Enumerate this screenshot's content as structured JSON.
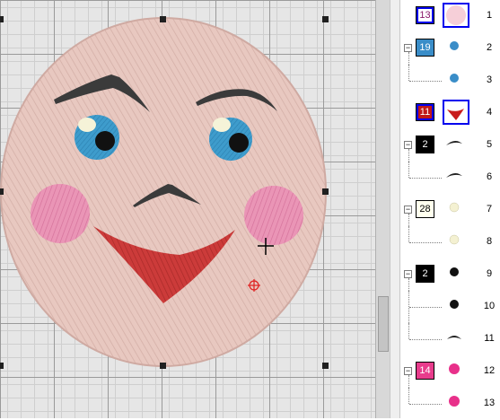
{
  "canvas": {
    "grid_color": "#9a9a9a",
    "background_color": "#e6e6e6",
    "face_color": "#e8c8c0",
    "eyebrow_color": "#3b3b3b",
    "eye_color": "#3a9ac8",
    "cheek_color": "#e890b4",
    "mouth_color": "#cc3b3a"
  },
  "color_sequence": [
    {
      "index": "1",
      "swatch": "13",
      "swatch_color": "#ffffff",
      "swatch_text_color": "#8a1a6a",
      "shape": "circle-pink-icon",
      "selected": true,
      "expander": ""
    },
    {
      "index": "2",
      "swatch": "19",
      "swatch_color": "#3a8dc8",
      "swatch_text_color": "#ffffff",
      "shape": "dot-blue-icon",
      "selected": false,
      "expander": "−"
    },
    {
      "index": "3",
      "swatch": "",
      "swatch_color": "",
      "swatch_text_color": "",
      "shape": "dot-blue-icon",
      "selected": false,
      "expander": ""
    },
    {
      "index": "4",
      "swatch": "11",
      "swatch_color": "#c01818",
      "swatch_text_color": "#ffffff",
      "shape": "mouth-red-icon",
      "selected": true,
      "expander": ""
    },
    {
      "index": "5",
      "swatch": "2",
      "swatch_color": "#000000",
      "swatch_text_color": "#ffffff",
      "shape": "eyebrow-icon",
      "selected": false,
      "expander": "−"
    },
    {
      "index": "6",
      "swatch": "",
      "swatch_color": "",
      "swatch_text_color": "",
      "shape": "eyebrow-icon",
      "selected": false,
      "expander": ""
    },
    {
      "index": "7",
      "swatch": "28",
      "swatch_color": "#ffffee",
      "swatch_text_color": "#000000",
      "shape": "dot-cream-icon",
      "selected": false,
      "expander": "−"
    },
    {
      "index": "8",
      "swatch": "",
      "swatch_color": "",
      "swatch_text_color": "",
      "shape": "dot-cream-icon",
      "selected": false,
      "expander": ""
    },
    {
      "index": "9",
      "swatch": "2",
      "swatch_color": "#000000",
      "swatch_text_color": "#ffffff",
      "shape": "dot-black-icon",
      "selected": false,
      "expander": "−"
    },
    {
      "index": "10",
      "swatch": "",
      "swatch_color": "",
      "swatch_text_color": "",
      "shape": "dot-black-icon",
      "selected": false,
      "expander": ""
    },
    {
      "index": "11",
      "swatch": "",
      "swatch_color": "",
      "swatch_text_color": "",
      "shape": "nose-icon",
      "selected": false,
      "expander": ""
    },
    {
      "index": "12",
      "swatch": "14",
      "swatch_color": "#e83c8c",
      "swatch_text_color": "#ffffff",
      "shape": "dot-pink-icon",
      "selected": false,
      "expander": "−"
    },
    {
      "index": "13",
      "swatch": "",
      "swatch_color": "",
      "swatch_text_color": "",
      "shape": "dot-pink-icon",
      "selected": false,
      "expander": ""
    }
  ]
}
